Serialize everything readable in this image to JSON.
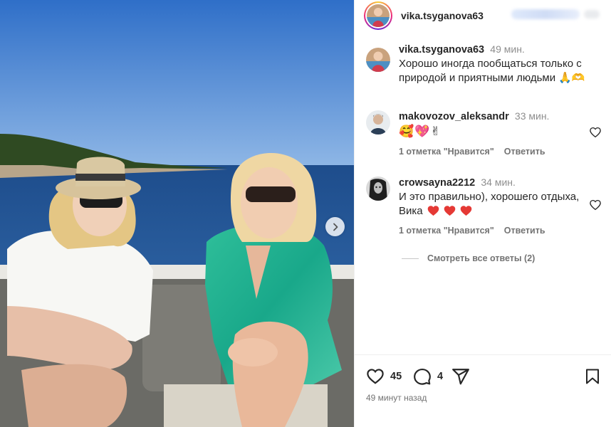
{
  "post": {
    "username": "vika.tsyganova63"
  },
  "caption": {
    "username": "vika.tsyganova63",
    "time": "49 мин.",
    "text_line1": "Хорошо иногда пообщаться только с",
    "text_line2": "природой и приятными людьми",
    "emojis": "🙏🫶"
  },
  "comments": [
    {
      "username": "makovozov_aleksandr",
      "time": "33 мин.",
      "text": "🥰💖✌",
      "likes": "1 отметка \"Нравится\"",
      "reply_label": "Ответить"
    },
    {
      "username": "crowsayna2212",
      "time": "34 мин.",
      "text_line1": "И это правильно), хорошего отдыха,",
      "text_line2": "Вика",
      "likes": "1 отметка \"Нравится\"",
      "reply_label": "Ответить"
    }
  ],
  "view_replies": "Смотреть все ответы (2)",
  "actions": {
    "like_count": "45",
    "comment_count": "4",
    "posted_ago": "49 минут назад"
  },
  "icons": {
    "like": "heart-icon",
    "comment": "comment-icon",
    "share": "share-icon",
    "save": "bookmark-icon",
    "next": "chevron-right-icon"
  }
}
